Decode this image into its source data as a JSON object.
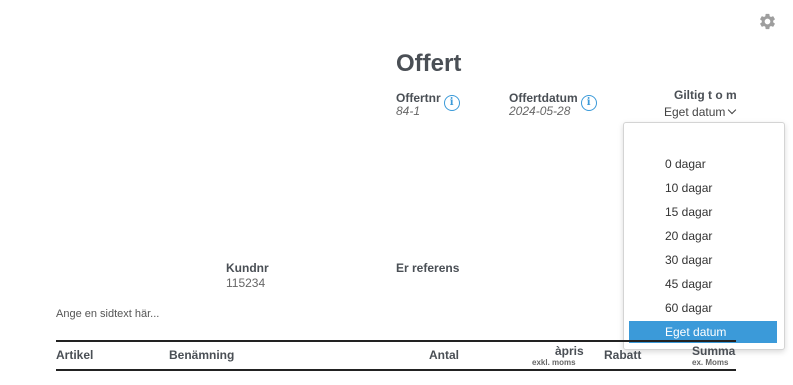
{
  "header": {
    "title": "Offert"
  },
  "offer": {
    "offertnr_label": "Offertnr",
    "offertnr_value": "84-1",
    "offertdatum_label": "Offertdatum",
    "offertdatum_value": "2024-05-28",
    "info_glyph": "i"
  },
  "validity": {
    "label": "Giltig t o m",
    "selected": "Eget datum",
    "options": [
      "0 dagar",
      "10 dagar",
      "15 dagar",
      "20 dagar",
      "30 dagar",
      "45 dagar",
      "60 dagar",
      "Eget datum"
    ]
  },
  "customer": {
    "kundnr_label": "Kundnr",
    "kundnr_value": "115234",
    "reference_label": "Er referens"
  },
  "sidetext": {
    "placeholder": "Ange en sidtext här..."
  },
  "table": {
    "columns": {
      "artikel": "Artikel",
      "benamning": "Benämning",
      "antal": "Antal",
      "apris": "àpris",
      "apris_sub": "exkl. moms",
      "rabatt": "Rabatt",
      "summa": "Summa",
      "summa_sub": "ex. Moms"
    }
  },
  "colors": {
    "accent": "#3b9ad9",
    "heading": "#4a4f55",
    "rule": "#222222"
  },
  "icons": {
    "settings": "gear-icon",
    "info": "info-icon",
    "dropdown": "chevron-down-icon"
  }
}
